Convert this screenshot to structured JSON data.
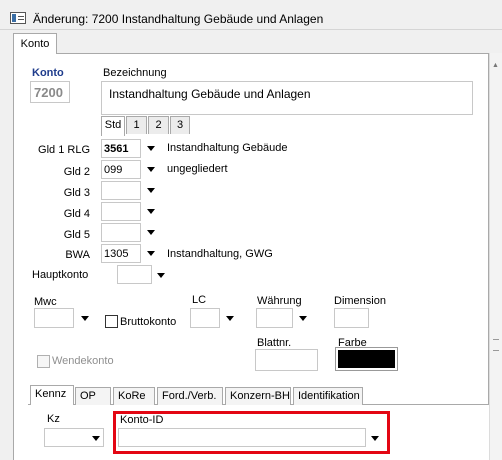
{
  "window": {
    "title": "Änderung: 7200 Instandhaltung Gebäude und Anlagen"
  },
  "top_tabs": [
    "Konto"
  ],
  "konto": {
    "label": "Konto",
    "value": "7200"
  },
  "bezeichnung": {
    "label": "Bezeichnung",
    "value": "Instandhaltung Gebäude und Anlagen"
  },
  "lang_tabs": [
    "Std",
    "1",
    "2",
    "3"
  ],
  "gld_rows": [
    {
      "label": "Gld 1 RLG",
      "value": "3561",
      "description": "Instandhaltung Gebäude"
    },
    {
      "label": "Gld 2",
      "value": "099",
      "description": "ungegliedert"
    },
    {
      "label": "Gld 3",
      "value": "",
      "description": ""
    },
    {
      "label": "Gld 4",
      "value": "",
      "description": ""
    },
    {
      "label": "Gld 5",
      "value": "",
      "description": ""
    },
    {
      "label": "BWA",
      "value": "1305",
      "description": "Instandhaltung, GWG"
    }
  ],
  "hauptkonto": {
    "label": "Hauptkonto",
    "value": ""
  },
  "mwc": {
    "label": "Mwc",
    "value": ""
  },
  "bruttokonto": {
    "label": "Bruttokonto",
    "checked": false
  },
  "lc": {
    "label": "LC",
    "value": ""
  },
  "waehrung": {
    "label": "Währung",
    "value": ""
  },
  "dimension": {
    "label": "Dimension",
    "value": ""
  },
  "wendekonto": {
    "label": "Wendekonto",
    "checked": false,
    "disabled": true
  },
  "blattnr": {
    "label": "Blattnr.",
    "value": ""
  },
  "farbe": {
    "label": "Farbe",
    "color": "#000000"
  },
  "bottom_tabs": [
    "Kennz",
    "OP",
    "KoRe",
    "Ford./Verb.",
    "Konzern-BH",
    "Identifikation"
  ],
  "kz": {
    "label": "Kz",
    "value": ""
  },
  "konto_id": {
    "label": "Konto-ID",
    "value": ""
  },
  "colors": {
    "highlight": "#e30613",
    "panel": "#ffffff",
    "background": "#f0f0f0"
  }
}
